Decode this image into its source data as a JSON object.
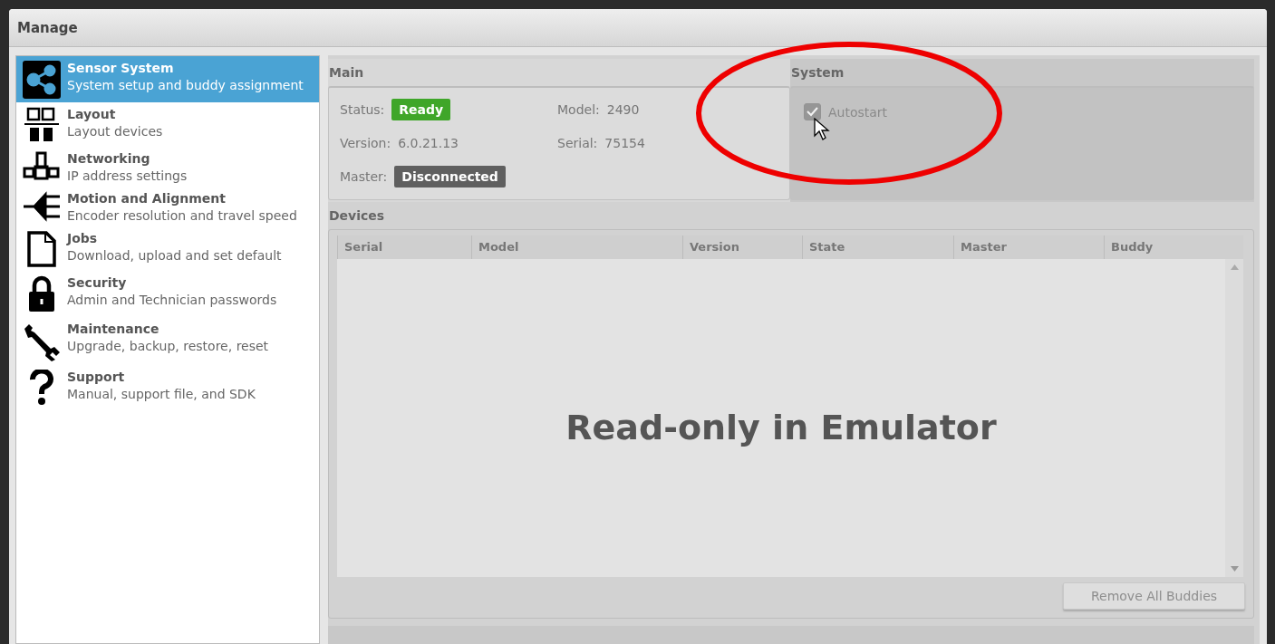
{
  "window": {
    "title": "Manage"
  },
  "sidebar": {
    "items": [
      {
        "title": "Sensor System",
        "subtitle": "System setup and buddy assignment",
        "selected": true
      },
      {
        "title": "Layout",
        "subtitle": "Layout devices",
        "selected": false
      },
      {
        "title": "Networking",
        "subtitle": "IP address settings",
        "selected": false
      },
      {
        "title": "Motion and Alignment",
        "subtitle": "Encoder resolution and travel speed",
        "selected": false
      },
      {
        "title": "Jobs",
        "subtitle": "Download, upload and set default",
        "selected": false
      },
      {
        "title": "Security",
        "subtitle": "Admin and Technician passwords",
        "selected": false
      },
      {
        "title": "Maintenance",
        "subtitle": "Upgrade, backup, restore, reset",
        "selected": false
      },
      {
        "title": "Support",
        "subtitle": "Manual, support file, and SDK",
        "selected": false
      }
    ]
  },
  "main": {
    "heading": "Main",
    "fields": [
      {
        "label": "Status:",
        "value": "Ready",
        "kind": "badge",
        "color": "#3fa629"
      },
      {
        "label": "Model:",
        "value": "2490",
        "kind": "text"
      },
      {
        "label": "Version:",
        "value": "6.0.21.13",
        "kind": "text"
      },
      {
        "label": "Serial:",
        "value": "75154",
        "kind": "text"
      },
      {
        "label": "Master:",
        "value": "Disconnected",
        "kind": "badge",
        "color": "#5f5f5f"
      }
    ]
  },
  "system": {
    "heading": "System",
    "autostart": {
      "label": "Autostart",
      "checked": true,
      "disabled": true
    }
  },
  "devices": {
    "heading": "Devices",
    "columns": [
      "Serial",
      "Model",
      "Version",
      "State",
      "Master",
      "Buddy"
    ],
    "overlay": "Read-only in Emulator",
    "button": {
      "label": "Remove All Buddies",
      "disabled": true
    }
  }
}
